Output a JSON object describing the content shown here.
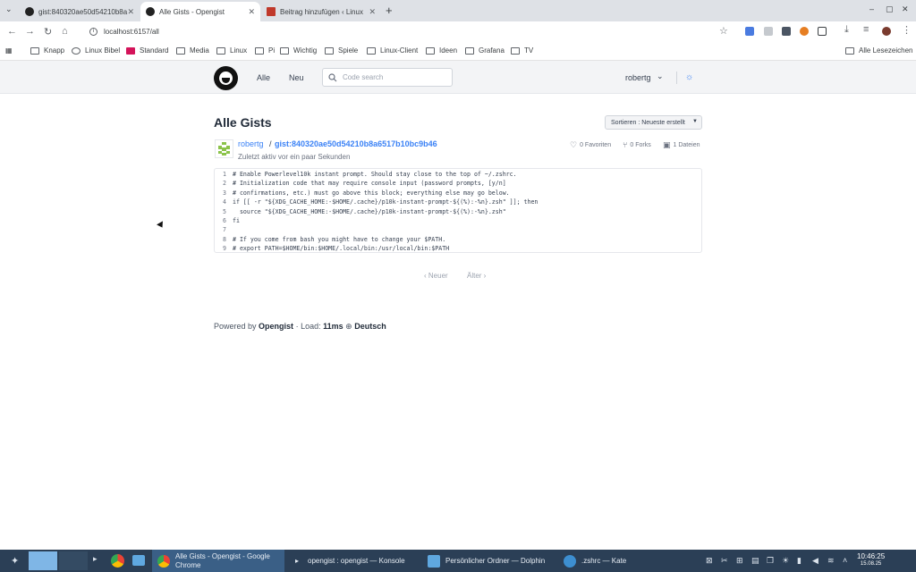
{
  "browser": {
    "tabs": [
      {
        "title": "gist:840320ae50d54210b8a",
        "active": false
      },
      {
        "title": "Alle Gists - Opengist",
        "active": true
      },
      {
        "title": "Beitrag hinzufügen ‹ Linux",
        "active": false
      }
    ],
    "url": "localhost:6157/all",
    "bookmarks": [
      "Knapp",
      "Linux Bibel",
      "Standard",
      "Media",
      "Linux",
      "Pi",
      "Wichtig",
      "Spiele",
      "Linux-Client",
      "Ideen",
      "Grafana",
      "TV"
    ],
    "all_bookmarks": "Alle Lesezeichen"
  },
  "navbar": {
    "links": [
      "Alle",
      "Neu"
    ],
    "search_placeholder": "Code search",
    "username": "robertg"
  },
  "page": {
    "title": "Alle Gists",
    "sort_label": "Sortieren : Neueste erstellt",
    "gist": {
      "owner": "robertg",
      "separator": "/",
      "name": "gist:840320ae50d54210b8a6517b10bc9b46",
      "updated": "Zuletzt aktiv vor ein paar Sekunden",
      "favorites": "0 Favoriten",
      "forks": "0 Forks",
      "files": "1 Dateien",
      "lines": [
        {
          "n": "1",
          "text": "# Enable Powerlevel10k instant prompt. Should stay close to the top of ~/.zshrc."
        },
        {
          "n": "2",
          "text": "# Initialization code that may require console input (password prompts, [y/n]"
        },
        {
          "n": "3",
          "text": "# confirmations, etc.) must go above this block; everything else may go below."
        },
        {
          "n": "4",
          "text": "if [[ -r \"${XDG_CACHE_HOME:-$HOME/.cache}/p10k-instant-prompt-${(%):-%n}.zsh\" ]]; then"
        },
        {
          "n": "5",
          "text": "  source \"${XDG_CACHE_HOME:-$HOME/.cache}/p10k-instant-prompt-${(%):-%n}.zsh\""
        },
        {
          "n": "6",
          "text": "fi"
        },
        {
          "n": "7",
          "text": ""
        },
        {
          "n": "8",
          "text": "# If you come from bash you might have to change your $PATH."
        },
        {
          "n": "9",
          "text": "# export PATH=$HOME/bin:$HOME/.local/bin:/usr/local/bin:$PATH"
        }
      ]
    },
    "pager": {
      "newer": "Neuer",
      "older": "Älter"
    },
    "footer": {
      "powered": "Powered by",
      "brand": "Opengist",
      "load_label": "· Load:",
      "load_value": "11ms",
      "language": "Deutsch"
    }
  },
  "taskbar": {
    "windows": [
      {
        "title": "Alle Gists - Opengist - Google Chrome",
        "active": true
      },
      {
        "title": "opengist : opengist — Konsole",
        "active": false
      },
      {
        "title": "Persönlicher Ordner — Dolphin",
        "active": false
      },
      {
        "title": ".zshrc — Kate",
        "active": false
      }
    ],
    "time": "10:46:25",
    "date": "15.08.25"
  },
  "colors": {
    "accent": "#3b82f6",
    "taskbar": "#2b3f56",
    "navbar": "#f3f4f6"
  }
}
